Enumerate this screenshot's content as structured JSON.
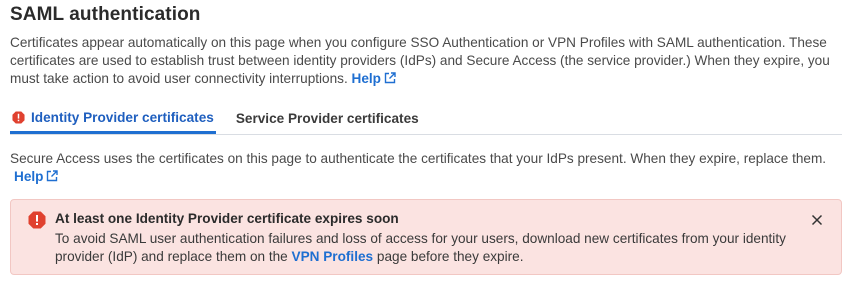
{
  "page": {
    "title": "SAML authentication",
    "intro_text": "Certificates appear automatically on this page when you configure SSO Authentication or VPN Profiles with SAML authentication. These certificates are used to establish trust between identity providers (IdPs) and Secure Access (the service provider.) When they expire, you must take action to avoid user connectivity interruptions.",
    "intro_help_link": "Help"
  },
  "tabs": [
    {
      "label": "Identity Provider certificates",
      "active": true,
      "icon": "warning-icon"
    },
    {
      "label": "Service Provider certificates",
      "active": false
    }
  ],
  "tab_content": {
    "description": "Secure Access uses the certificates on this page to authenticate the certificates that your IdPs present. When they expire, replace them.",
    "help_link": "Help"
  },
  "alert": {
    "title": "At least one Identity Provider certificate expires soon",
    "body_before_link": "To avoid SAML user authentication failures and loss of access for your users, download new certificates from your identity provider (IdP) and replace them on the ",
    "body_link": "VPN Profiles",
    "body_after_link": " page before they expire.",
    "icon": "error-icon",
    "close_icon": "close-icon"
  },
  "colors": {
    "link": "#1f6fd1",
    "active_tab": "#1f5fbf",
    "alert_bg": "#fbe3e1",
    "alert_border": "#f2c7c3",
    "error_red": "#e0412f"
  }
}
